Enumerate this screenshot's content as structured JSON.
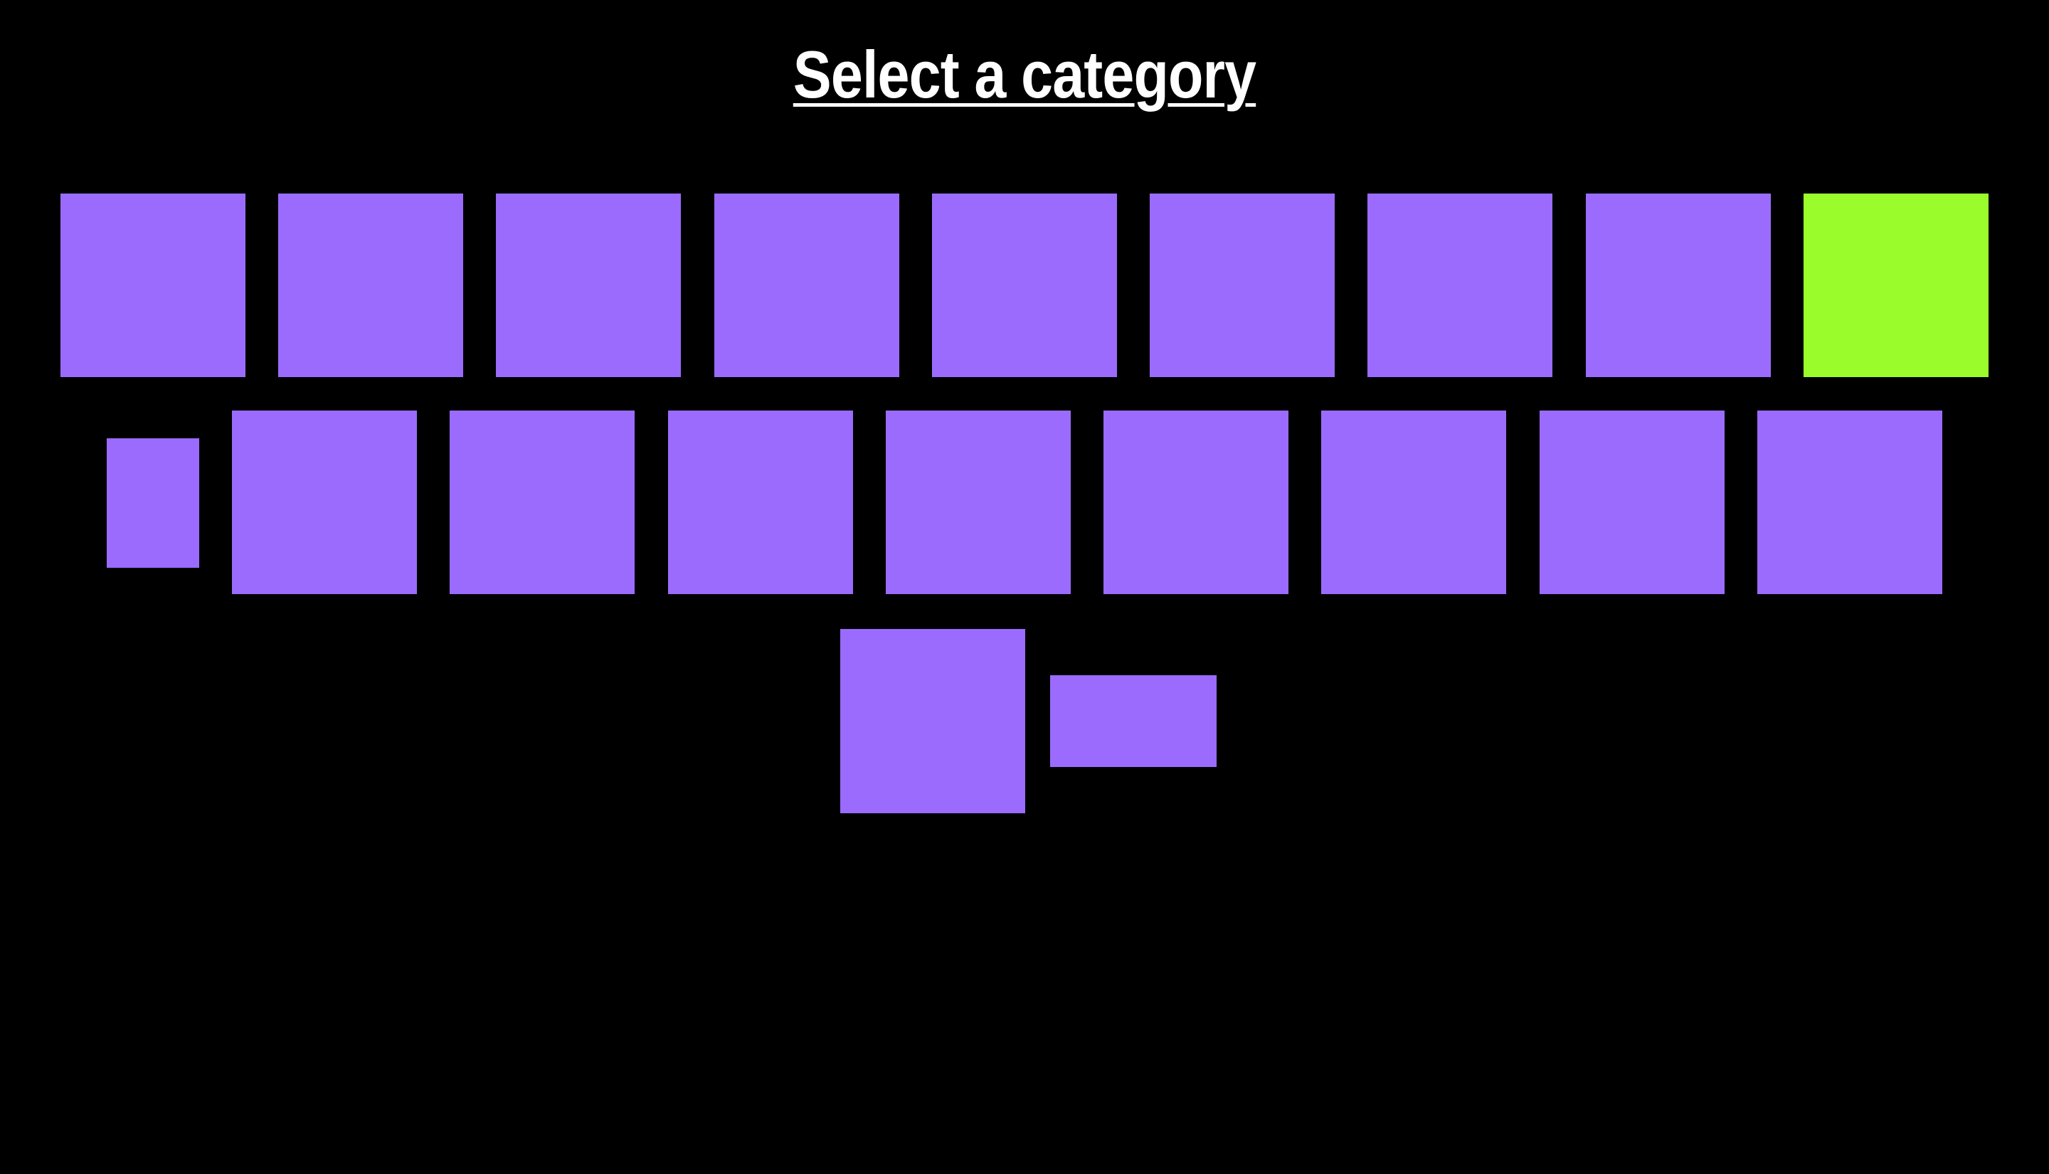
{
  "title": "Select a category",
  "colors": {
    "background": "#000000",
    "tile": "#9b6bfd",
    "tile_selected": "#9bfc2b",
    "title_text": "#ffffff"
  },
  "grid": {
    "selected_index": 8,
    "rows": [
      {
        "tiles": [
          {
            "id": "tile-1-1",
            "state": "default"
          },
          {
            "id": "tile-1-2",
            "state": "default"
          },
          {
            "id": "tile-1-3",
            "state": "default"
          },
          {
            "id": "tile-1-4",
            "state": "default"
          },
          {
            "id": "tile-1-5",
            "state": "default"
          },
          {
            "id": "tile-1-6",
            "state": "default"
          },
          {
            "id": "tile-1-7",
            "state": "default"
          },
          {
            "id": "tile-1-8",
            "state": "default"
          },
          {
            "id": "tile-1-9",
            "state": "selected"
          }
        ]
      },
      {
        "tiles": [
          {
            "id": "tile-2-1",
            "state": "default"
          },
          {
            "id": "tile-2-2",
            "state": "default"
          },
          {
            "id": "tile-2-3",
            "state": "default"
          },
          {
            "id": "tile-2-4",
            "state": "default"
          },
          {
            "id": "tile-2-5",
            "state": "default"
          },
          {
            "id": "tile-2-6",
            "state": "default"
          },
          {
            "id": "tile-2-7",
            "state": "default"
          },
          {
            "id": "tile-2-8",
            "state": "default"
          },
          {
            "id": "tile-2-9",
            "state": "default"
          }
        ]
      },
      {
        "tiles": [
          {
            "id": "tile-3-1",
            "state": "default"
          },
          {
            "id": "tile-3-2",
            "state": "default"
          }
        ]
      }
    ]
  }
}
